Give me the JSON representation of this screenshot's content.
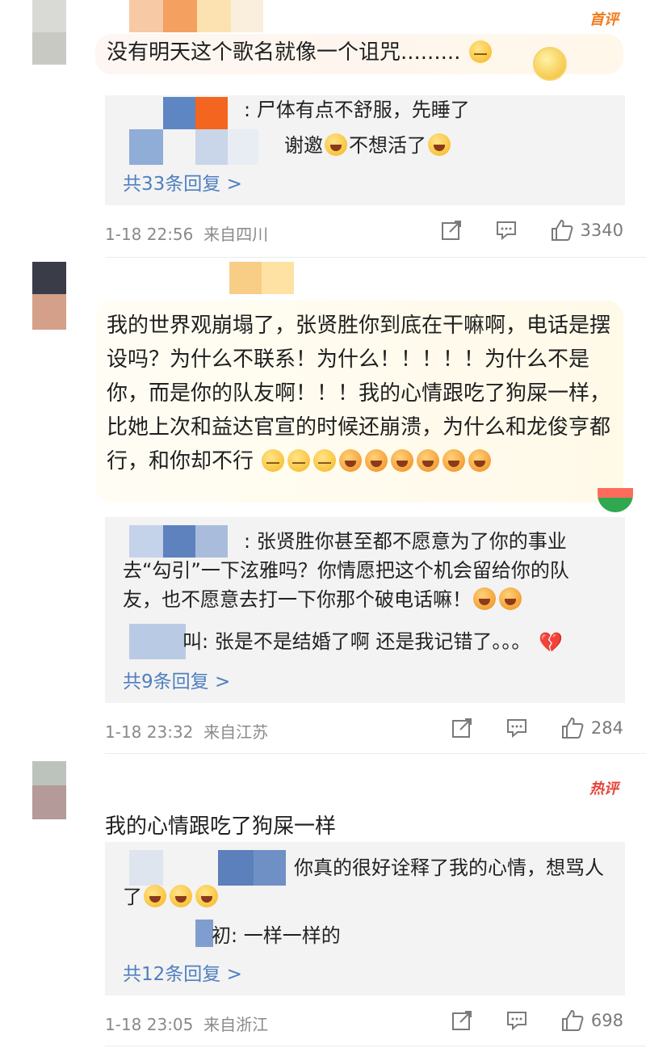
{
  "comments": [
    {
      "badge": "首评",
      "text": "没有明天这个歌名就像一个诅咒.........",
      "replies": [
        {
          "text": ": 尸体有点不舒服，先睡了"
        },
        {
          "text": "谢邀",
          "suffix": "不想活了"
        }
      ],
      "more": "共33条回复 >",
      "time": "1-18 22:56",
      "location": "来自四川",
      "likes": "3340"
    },
    {
      "text": "我的世界观崩塌了，张贤胜你到底在干嘛啊，电话是摆设吗？为什么不联系！为什么！！！！！为什么不是你，而是你的队友啊！！！我的心情跟吃了狗屎一样，比她上次和益达官宣的时候还崩溃，为什么和龙俊亨都行，和你却不行",
      "replies": [
        {
          "text": ": 张贤胜你甚至都不愿意为了你的事业去“勾引”一下泫雅吗？你情愿把这个机会留给你的队友，也不愿意去打一下你那个破电话嘛！"
        },
        {
          "prefix": "叫",
          "text": ": 张是不是结婚了啊 还是我记错了。。。"
        }
      ],
      "more": "共9条回复 >",
      "time": "1-18 23:32",
      "location": "来自江苏",
      "likes": "284"
    },
    {
      "badge": "热评",
      "text": "我的心情跟吃了狗屎一样",
      "replies": [
        {
          "text": "你真的很好诠释了我的心情，想骂人了"
        },
        {
          "prefix": "初",
          "text": ": 一样一样的"
        }
      ],
      "more": "共12条回复 >",
      "time": "1-18 23:05",
      "location": "来自浙江",
      "likes": "698"
    }
  ],
  "colors": {
    "link": "#4f7fbf",
    "badge_first": "#f07a1a",
    "badge_hot": "#e8443a",
    "reply_bg": "#f3f3f3"
  }
}
